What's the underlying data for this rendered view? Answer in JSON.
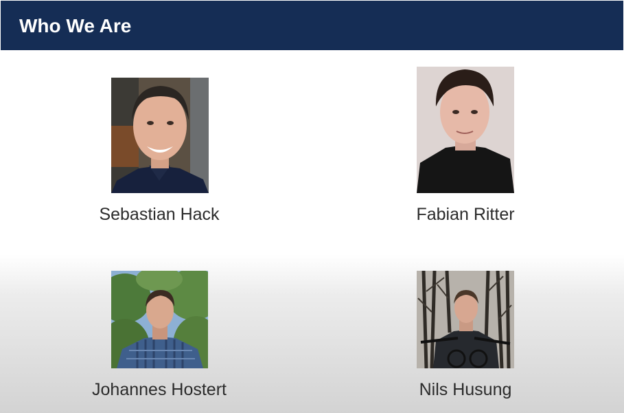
{
  "slide": {
    "title": "Who We Are"
  },
  "people": [
    {
      "name": "Sebastian Hack"
    },
    {
      "name": "Fabian Ritter"
    },
    {
      "name": "Johannes Hostert"
    },
    {
      "name": "Nils Husung"
    }
  ]
}
